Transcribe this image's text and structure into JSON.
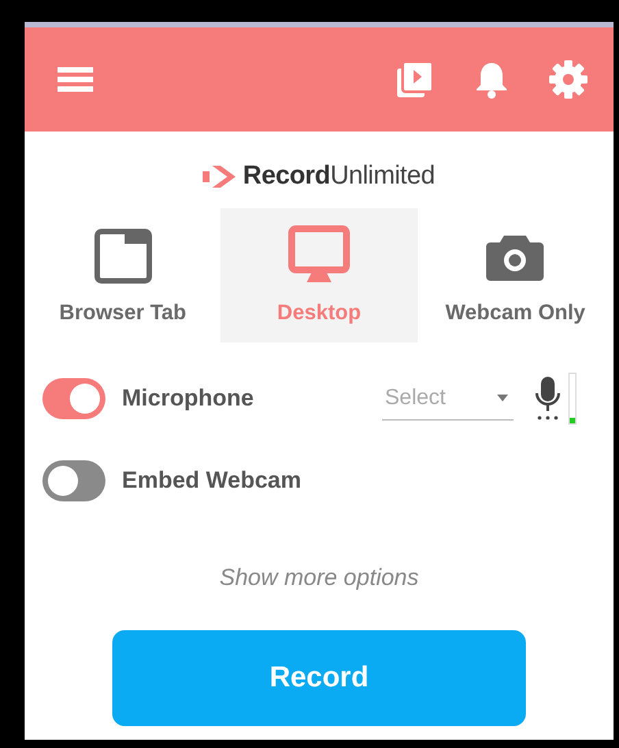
{
  "logo": {
    "text": "**Record**Unlimited"
  },
  "modes": [
    {
      "kind": "tab",
      "label": "Browser Tab",
      "selected": false
    },
    {
      "kind": "desktop",
      "label": "Desktop",
      "selected": true
    },
    {
      "kind": "webcam",
      "label": "Webcam Only",
      "selected": false
    }
  ],
  "options": [
    {
      "label": "Microphone",
      "on": true,
      "select": {
        "placeholder": "Select"
      },
      "meter": {
        "level": 0.12
      }
    },
    {
      "label": "Embed Webcam",
      "on": false
    }
  ],
  "more_link": "Show more options",
  "record_button": "Record"
}
